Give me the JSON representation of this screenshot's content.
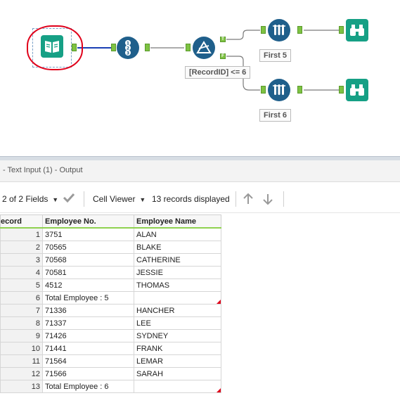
{
  "canvas": {
    "filter_expression": "[RecordID] <= 6",
    "filter_true_label": "T",
    "filter_false_label": "F",
    "sample_top_label": "First 5",
    "sample_bottom_label": "First 6",
    "text_input_icon": "book-icon",
    "record_id_icon": "record-id-icon",
    "filter_icon": "filter-icon",
    "sample_icon": "test-tubes-icon",
    "browse_icon": "binoculars-icon",
    "selection_highlight_color": "#e0001a",
    "tool_blue": "#1f5f8b",
    "tool_teal": "#16a085",
    "anchor_green": "#7ec242"
  },
  "results": {
    "title": "- Text Input (1) - Output",
    "fields_label": "2 of 2 Fields",
    "cell_viewer_label": "Cell Viewer",
    "records_label": "13 records displayed"
  },
  "grid": {
    "columns": [
      "ecord",
      "Employee No.",
      "Employee Name"
    ],
    "rows": [
      {
        "rec": "1",
        "no": "3751",
        "name": "ALAN",
        "flag": false
      },
      {
        "rec": "2",
        "no": "70565",
        "name": "BLAKE",
        "flag": false
      },
      {
        "rec": "3",
        "no": "70568",
        "name": "CATHERINE",
        "flag": false
      },
      {
        "rec": "4",
        "no": "70581",
        "name": "JESSIE",
        "flag": false
      },
      {
        "rec": "5",
        "no": "4512",
        "name": "THOMAS",
        "flag": false
      },
      {
        "rec": "6",
        "no": "Total Employee : 5",
        "name": "",
        "flag": true
      },
      {
        "rec": "7",
        "no": "71336",
        "name": "HANCHER",
        "flag": false
      },
      {
        "rec": "8",
        "no": "71337",
        "name": "LEE",
        "flag": false
      },
      {
        "rec": "9",
        "no": "71426",
        "name": "SYDNEY",
        "flag": false
      },
      {
        "rec": "10",
        "no": "71441",
        "name": "FRANK",
        "flag": false
      },
      {
        "rec": "11",
        "no": "71564",
        "name": "LEMAR",
        "flag": false
      },
      {
        "rec": "12",
        "no": "71566",
        "name": "SARAH",
        "flag": false
      },
      {
        "rec": "13",
        "no": "Total Employee : 6",
        "name": "",
        "flag": true
      }
    ]
  }
}
